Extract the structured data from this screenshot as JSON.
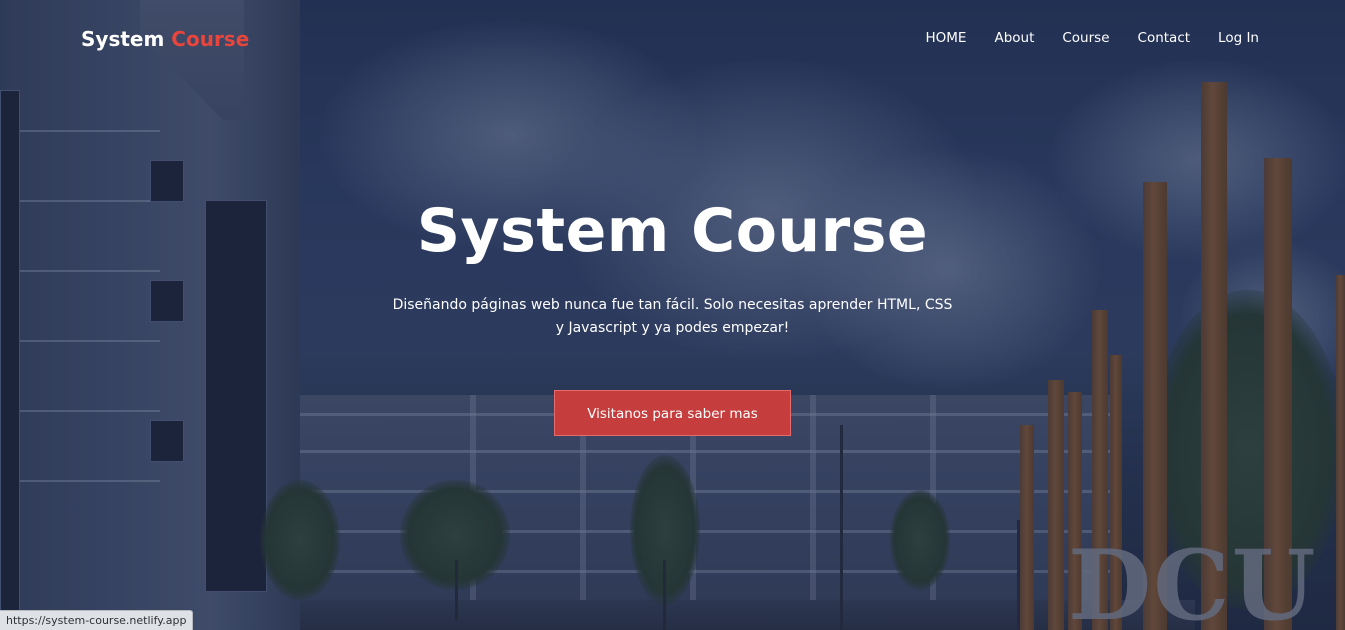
{
  "brand": {
    "prefix": "System",
    "accent": "Course",
    "accent_color": "#e8453c"
  },
  "nav": {
    "items": [
      {
        "label": "HOME"
      },
      {
        "label": "About"
      },
      {
        "label": "Course"
      },
      {
        "label": "Contact"
      },
      {
        "label": "Log In"
      }
    ]
  },
  "hero": {
    "title": "System Course",
    "subtitle": "Diseñando páginas web nunca fue tan fácil. Solo necesitas aprender HTML, CSS y Javascript y ya podes empezar!",
    "cta_label": "Visitanos para saber mas",
    "cta_color": "#c63d3d"
  },
  "background": {
    "sign_text": "DCU"
  },
  "statusbar": {
    "url": "https://system-course.netlify.app"
  }
}
